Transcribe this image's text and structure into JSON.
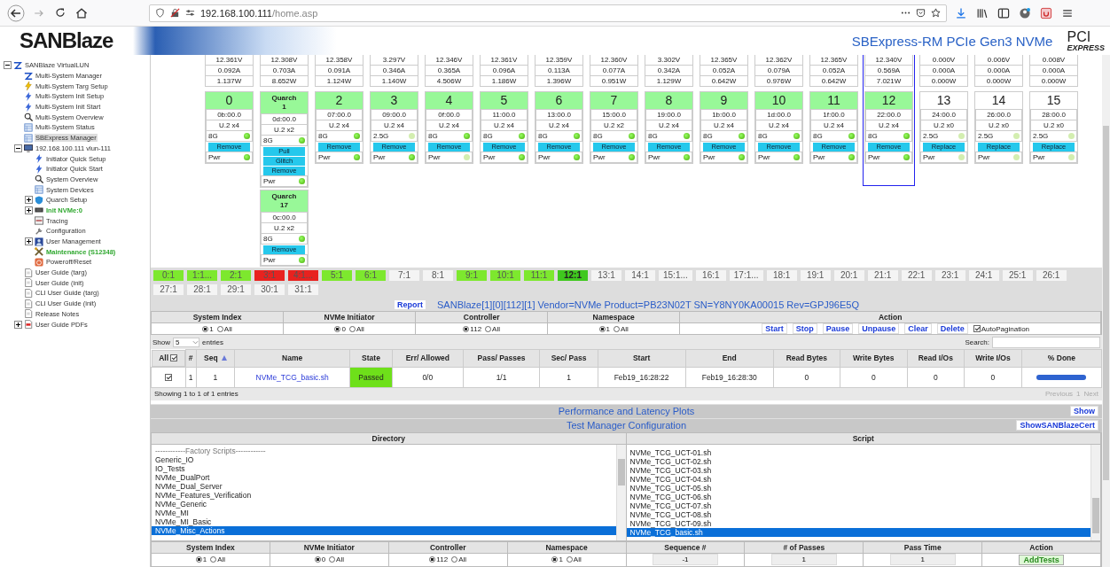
{
  "browser": {
    "url_host": "192.168.100.111",
    "url_path": "/home.asp"
  },
  "header": {
    "logo": "SANBlaze",
    "title": "SBExpress-RM PCIe Gen3 NVMe",
    "pci_logo": "PCI",
    "pci_logo_sub": "EXPRESS"
  },
  "sidebar": {
    "items": [
      {
        "label": "SANBlaze VirtualLUN",
        "kind": "z",
        "expanded": true,
        "selected": false,
        "children": [
          {
            "label": "Multi-System Manager",
            "kind": "z",
            "selected": false
          },
          {
            "label": "Multi-System Targ Setup",
            "kind": "target",
            "selected": false
          },
          {
            "label": "Multi-System Init Setup",
            "kind": "initiator",
            "selected": false
          },
          {
            "label": "Multi-System Init Start",
            "kind": "initiator",
            "selected": false
          },
          {
            "label": "Multi-System Overview",
            "kind": "search",
            "selected": false
          },
          {
            "label": "Multi-System Status",
            "kind": "grid",
            "selected": false
          },
          {
            "label": "SBExpress Manager",
            "kind": "grid",
            "selected": true
          },
          {
            "label": "192.168.100.111 vlun-111",
            "kind": "host",
            "expanded": true,
            "selected": false,
            "children": [
              {
                "label": "Initiator Quick Setup",
                "kind": "initiator",
                "selected": false
              },
              {
                "label": "Initiator Quick Start",
                "kind": "initiator",
                "selected": false
              },
              {
                "label": "System Overview",
                "kind": "search",
                "selected": false
              },
              {
                "label": "System Devices",
                "kind": "grid",
                "selected": false
              },
              {
                "label": "Quarch Setup",
                "kind": "quarch",
                "expanded": false,
                "selected": false
              },
              {
                "label": "Init NVMe:0",
                "kind": "chip",
                "expanded": false,
                "selected": false,
                "color": "#2fa82f"
              },
              {
                "label": "Tracing",
                "kind": "trace",
                "selected": false
              },
              {
                "label": "Configuration",
                "kind": "wrench",
                "selected": false
              },
              {
                "label": "User Management",
                "kind": "users",
                "expanded": false,
                "selected": false
              },
              {
                "label": "Maintenance (S12348)",
                "kind": "tools",
                "selected": false,
                "color": "#2fa82f"
              },
              {
                "label": "Poweroff/Reset",
                "kind": "power",
                "selected": false
              }
            ]
          },
          {
            "label": "User Guide (targ)",
            "kind": "doc",
            "selected": false
          },
          {
            "label": "User Guide (init)",
            "kind": "doc",
            "selected": false
          },
          {
            "label": "CLI User Guide (targ)",
            "kind": "doc",
            "selected": false
          },
          {
            "label": "CLI User Guide (init)",
            "kind": "doc",
            "selected": false
          },
          {
            "label": "Release Notes",
            "kind": "doc",
            "selected": false
          },
          {
            "label": "User Guide PDFs",
            "kind": "pdf",
            "expanded": false,
            "selected": false
          }
        ]
      }
    ]
  },
  "slots": [
    {
      "voltage": "12.361V",
      "current": "0.092A",
      "power": "1.137W",
      "selected": false,
      "cards": [
        {
          "kind": "slot",
          "number": "0",
          "addr": "0b:00.0",
          "form": "U.2 x4",
          "link": "8G",
          "link_on": true,
          "buttons": [
            "Remove"
          ],
          "pwr": "Pwr",
          "pwr_on": true,
          "active": true
        }
      ]
    },
    {
      "voltage": "12.308V",
      "current": "0.703A",
      "power": "8.652W",
      "selected": false,
      "cards": [
        {
          "kind": "quarch",
          "label": "Quarch",
          "number": "1",
          "addr": "0d:00.0",
          "form": "U.2 x2",
          "link": "8G",
          "link_on": true,
          "buttons": [
            "Pull",
            "Glitch",
            "Remove"
          ],
          "pwr": "Pwr",
          "pwr_on": true,
          "active": true
        },
        {
          "kind": "quarch",
          "label": "Quarch",
          "number": "17",
          "addr": "0c:00.0",
          "form": "U.2 x2",
          "link": "8G",
          "link_on": true,
          "buttons": [
            "Remove"
          ],
          "pwr": "Pwr",
          "pwr_on": true,
          "active": true
        }
      ]
    },
    {
      "voltage": "12.358V",
      "current": "0.091A",
      "power": "1.124W",
      "selected": false,
      "cards": [
        {
          "kind": "slot",
          "number": "2",
          "addr": "07:00.0",
          "form": "U.2 x4",
          "link": "8G",
          "link_on": true,
          "buttons": [
            "Remove"
          ],
          "pwr": "Pwr",
          "pwr_on": true,
          "active": true
        }
      ]
    },
    {
      "voltage": "3.297V",
      "current": "0.346A",
      "power": "1.140W",
      "selected": false,
      "cards": [
        {
          "kind": "slot",
          "number": "3",
          "addr": "09:00.0",
          "form": "U.2 x4",
          "link": "2.5G",
          "link_on": false,
          "buttons": [
            "Remove"
          ],
          "pwr": "Pwr",
          "pwr_on": true,
          "active": true
        }
      ]
    },
    {
      "voltage": "12.346V",
      "current": "0.365A",
      "power": "4.506W",
      "selected": false,
      "cards": [
        {
          "kind": "slot",
          "number": "4",
          "addr": "0f:00.0",
          "form": "U.2 x4",
          "link": "8G",
          "link_on": true,
          "buttons": [
            "Remove"
          ],
          "pwr": "Pwr",
          "pwr_on": false,
          "active": true
        }
      ]
    },
    {
      "voltage": "12.361V",
      "current": "0.096A",
      "power": "1.186W",
      "selected": false,
      "cards": [
        {
          "kind": "slot",
          "number": "5",
          "addr": "11:00.0",
          "form": "U.2 x4",
          "link": "8G",
          "link_on": true,
          "buttons": [
            "Remove"
          ],
          "pwr": "Pwr",
          "pwr_on": true,
          "active": true
        }
      ]
    },
    {
      "voltage": "12.359V",
      "current": "0.113A",
      "power": "1.396W",
      "selected": false,
      "cards": [
        {
          "kind": "slot",
          "number": "6",
          "addr": "13:00.0",
          "form": "U.2 x4",
          "link": "8G",
          "link_on": true,
          "buttons": [
            "Remove"
          ],
          "pwr": "Pwr",
          "pwr_on": true,
          "active": true
        }
      ]
    },
    {
      "voltage": "12.360V",
      "current": "0.077A",
      "power": "0.951W",
      "selected": false,
      "cards": [
        {
          "kind": "slot",
          "number": "7",
          "addr": "15:00.0",
          "form": "U.2 x2",
          "link": "8G",
          "link_on": true,
          "buttons": [
            "Remove"
          ],
          "pwr": "Pwr",
          "pwr_on": true,
          "active": true
        }
      ]
    },
    {
      "voltage": "3.302V",
      "current": "0.342A",
      "power": "1.129W",
      "selected": false,
      "cards": [
        {
          "kind": "slot",
          "number": "8",
          "addr": "19:00.0",
          "form": "U.2 x4",
          "link": "8G",
          "link_on": true,
          "buttons": [
            "Remove"
          ],
          "pwr": "Pwr",
          "pwr_on": true,
          "active": true
        }
      ]
    },
    {
      "voltage": "12.365V",
      "current": "0.052A",
      "power": "0.642W",
      "selected": false,
      "cards": [
        {
          "kind": "slot",
          "number": "9",
          "addr": "1b:00.0",
          "form": "U.2 x4",
          "link": "8G",
          "link_on": true,
          "buttons": [
            "Remove"
          ],
          "pwr": "Pwr",
          "pwr_on": true,
          "active": true
        }
      ]
    },
    {
      "voltage": "12.362V",
      "current": "0.079A",
      "power": "0.976W",
      "selected": false,
      "cards": [
        {
          "kind": "slot",
          "number": "10",
          "addr": "1d:00.0",
          "form": "U.2 x4",
          "link": "8G",
          "link_on": true,
          "buttons": [
            "Remove"
          ],
          "pwr": "Pwr",
          "pwr_on": true,
          "active": true
        }
      ]
    },
    {
      "voltage": "12.365V",
      "current": "0.052A",
      "power": "0.642W",
      "selected": false,
      "cards": [
        {
          "kind": "slot",
          "number": "11",
          "addr": "1f:00.0",
          "form": "U.2 x4",
          "link": "8G",
          "link_on": true,
          "buttons": [
            "Remove"
          ],
          "pwr": "Pwr",
          "pwr_on": true,
          "active": true
        }
      ]
    },
    {
      "voltage": "12.340V",
      "current": "0.569A",
      "power": "7.021W",
      "selected": true,
      "cards": [
        {
          "kind": "slot",
          "number": "12",
          "addr": "22:00.0",
          "form": "U.2 x4",
          "link": "8G",
          "link_on": true,
          "buttons": [
            "Remove"
          ],
          "pwr": "Pwr",
          "pwr_on": true,
          "active": true
        }
      ]
    },
    {
      "voltage": "0.000V",
      "current": "0.000A",
      "power": "0.000W",
      "selected": false,
      "cards": [
        {
          "kind": "slot",
          "number": "13",
          "addr": "24:00.0",
          "form": "U.2 x0",
          "link": "2.5G",
          "link_on": false,
          "buttons": [
            "Replace"
          ],
          "pwr": "Pwr",
          "pwr_on": false,
          "active": false
        }
      ]
    },
    {
      "voltage": "0.006V",
      "current": "0.000A",
      "power": "0.000W",
      "selected": false,
      "cards": [
        {
          "kind": "slot",
          "number": "14",
          "addr": "26:00.0",
          "form": "U.2 x0",
          "link": "2.5G",
          "link_on": false,
          "buttons": [
            "Replace"
          ],
          "pwr": "Pwr",
          "pwr_on": false,
          "active": false
        }
      ]
    },
    {
      "voltage": "0.008V",
      "current": "0.000A",
      "power": "0.000W",
      "selected": false,
      "cards": [
        {
          "kind": "slot",
          "number": "15",
          "addr": "28:00.0",
          "form": "U.2 x0",
          "link": "2.5G",
          "link_on": false,
          "buttons": [
            "Replace"
          ],
          "pwr": "Pwr",
          "pwr_on": false,
          "active": false
        }
      ]
    }
  ],
  "ports": [
    {
      "label": "0:1",
      "color": "#7de82e",
      "selected": false
    },
    {
      "label": "1:1...",
      "color": "#7de82e",
      "selected": false
    },
    {
      "label": "2:1",
      "color": "#7de82e",
      "selected": false
    },
    {
      "label": "3:1",
      "color": "#e8221f",
      "selected": false
    },
    {
      "label": "4:1...",
      "color": "#e8221f",
      "selected": false
    },
    {
      "label": "5:1",
      "color": "#7de82e",
      "selected": false
    },
    {
      "label": "6:1",
      "color": "#7de82e",
      "selected": false
    },
    {
      "label": "7:1",
      "color": "#f4f4f4",
      "selected": false
    },
    {
      "label": "8:1",
      "color": "#f4f4f4",
      "selected": false
    },
    {
      "label": "9:1",
      "color": "#7de82e",
      "selected": false
    },
    {
      "label": "10:1",
      "color": "#7de82e",
      "selected": false
    },
    {
      "label": "11:1",
      "color": "#7de82e",
      "selected": false
    },
    {
      "label": "12:1",
      "color": "#3fc81e",
      "selected": true
    },
    {
      "label": "13:1",
      "color": "#f4f4f4",
      "selected": false
    },
    {
      "label": "14:1",
      "color": "#f4f4f4",
      "selected": false
    },
    {
      "label": "15:1...",
      "color": "#f4f4f4",
      "selected": false
    },
    {
      "label": "16:1",
      "color": "#f4f4f4",
      "selected": false
    },
    {
      "label": "17:1...",
      "color": "#f4f4f4",
      "selected": false
    },
    {
      "label": "18:1",
      "color": "#f4f4f4",
      "selected": false
    },
    {
      "label": "19:1",
      "color": "#f4f4f4",
      "selected": false
    },
    {
      "label": "20:1",
      "color": "#f4f4f4",
      "selected": false
    },
    {
      "label": "21:1",
      "color": "#f4f4f4",
      "selected": false
    },
    {
      "label": "22:1",
      "color": "#f4f4f4",
      "selected": false
    },
    {
      "label": "23:1",
      "color": "#f4f4f4",
      "selected": false
    },
    {
      "label": "24:1",
      "color": "#f4f4f4",
      "selected": false
    },
    {
      "label": "25:1",
      "color": "#f4f4f4",
      "selected": false
    },
    {
      "label": "26:1",
      "color": "#f4f4f4",
      "selected": false
    },
    {
      "label": "27:1",
      "color": "#f4f4f4",
      "selected": false
    },
    {
      "label": "28:1",
      "color": "#f4f4f4",
      "selected": false
    },
    {
      "label": "29:1",
      "color": "#f4f4f4",
      "selected": false
    },
    {
      "label": "30:1",
      "color": "#f4f4f4",
      "selected": false
    },
    {
      "label": "31:1",
      "color": "#f4f4f4",
      "selected": false
    }
  ],
  "report": {
    "button": "Report",
    "device": "SANBlaze[1][0][112][1] Vendor=NVMe Product=PB23N02T SN=Y8NY0KA00015 Rev=GPJ96E5Q"
  },
  "filters": [
    {
      "label": "System Index",
      "options": [
        {
          "label": "1",
          "selected": true
        },
        {
          "label": "All",
          "selected": false
        }
      ]
    },
    {
      "label": "NVMe Initiator",
      "options": [
        {
          "label": "0",
          "selected": true
        },
        {
          "label": "All",
          "selected": false
        }
      ]
    },
    {
      "label": "Controller",
      "options": [
        {
          "label": "112",
          "selected": true
        },
        {
          "label": "All",
          "selected": false
        }
      ]
    },
    {
      "label": "Namespace",
      "options": [
        {
          "label": "1",
          "selected": true
        },
        {
          "label": "All",
          "selected": false
        }
      ]
    }
  ],
  "actions": {
    "label": "Action",
    "buttons": [
      "Start",
      "Stop",
      "Pause",
      "Unpause",
      "Clear",
      "Delete"
    ],
    "auto_pagination": {
      "label": "AutoPagination",
      "checked": true
    }
  },
  "list_controls": {
    "show": "Show",
    "page_size": "5",
    "entries": "entries",
    "search": "Search:"
  },
  "table": {
    "all_label": "All",
    "all_checked": true,
    "columns": [
      "#",
      "Seq",
      "Name",
      "State",
      "Err/ Allowed",
      "Pass/ Passes",
      "Sec/ Pass",
      "Start",
      "End",
      "Read Bytes",
      "Write Bytes",
      "Read I/Os",
      "Write I/Os",
      "% Done"
    ],
    "rows": [
      {
        "checked": true,
        "index": "1",
        "seq": "1",
        "name": "NVMe_TCG_basic.sh",
        "state": "Passed",
        "err": "0/0",
        "passes": "1/1",
        "sec": "1",
        "start": "Feb19_16:28:22",
        "end": "Feb19_16:28:30",
        "read_bytes": "0",
        "write_bytes": "0",
        "read_ios": "0",
        "write_ios": "0",
        "level": 1
      }
    ]
  },
  "table_info": "Showing 1 to 1 of 1 entries",
  "pagination": {
    "previous": "Previous",
    "page": "1",
    "next": "Next",
    "disabled": true
  },
  "plots_bar": {
    "title": "Performance and Latency Plots",
    "button": "Show"
  },
  "config_bar": {
    "title": "Test Manager Configuration",
    "button": "ShowSANBlazeCert"
  },
  "directory": {
    "title": "Directory",
    "items": [
      {
        "label": "------------Factory Scripts------------",
        "kind": "heading",
        "selected": false
      },
      {
        "label": "Generic_IO",
        "kind": "item",
        "selected": false
      },
      {
        "label": "IO_Tests",
        "kind": "item",
        "selected": false
      },
      {
        "label": "NVMe_DualPort",
        "kind": "item",
        "selected": false
      },
      {
        "label": "NVMe_Dual_Server",
        "kind": "item",
        "selected": false
      },
      {
        "label": "NVMe_Features_Verification",
        "kind": "item",
        "selected": false
      },
      {
        "label": "NVMe_Generic",
        "kind": "item",
        "selected": false
      },
      {
        "label": "NVMe_MI",
        "kind": "item",
        "selected": false
      },
      {
        "label": "NVMe_MI_Basic",
        "kind": "item",
        "selected": false
      },
      {
        "label": "NVMe_Misc_Actions",
        "kind": "item",
        "selected": true
      }
    ]
  },
  "script": {
    "title": "Script",
    "items": [
      {
        "label": "NVMe_TCG_UCT-01.sh",
        "selected": false
      },
      {
        "label": "NVMe_TCG_UCT-02.sh",
        "selected": false
      },
      {
        "label": "NVMe_TCG_UCT-03.sh",
        "selected": false
      },
      {
        "label": "NVMe_TCG_UCT-04.sh",
        "selected": false
      },
      {
        "label": "NVMe_TCG_UCT-05.sh",
        "selected": false
      },
      {
        "label": "NVMe_TCG_UCT-06.sh",
        "selected": false
      },
      {
        "label": "NVMe_TCG_UCT-07.sh",
        "selected": false
      },
      {
        "label": "NVMe_TCG_UCT-08.sh",
        "selected": false
      },
      {
        "label": "NVMe_TCG_UCT-09.sh",
        "selected": false
      },
      {
        "label": "NVMe_TCG_basic.sh",
        "selected": true
      }
    ]
  },
  "add_form": {
    "filters": [
      {
        "label": "System Index",
        "options": [
          {
            "label": "1",
            "selected": true
          },
          {
            "label": "All",
            "selected": false
          }
        ]
      },
      {
        "label": "NVMe Initiator",
        "options": [
          {
            "label": "0",
            "selected": true
          },
          {
            "label": "All",
            "selected": false
          }
        ]
      },
      {
        "label": "Controller",
        "options": [
          {
            "label": "112",
            "selected": true
          },
          {
            "label": "All",
            "selected": false
          }
        ]
      },
      {
        "label": "Namespace",
        "options": [
          {
            "label": "1",
            "selected": true
          },
          {
            "label": "All",
            "selected": false
          }
        ]
      }
    ],
    "fields": [
      {
        "label": "Sequence #",
        "value": "-1"
      },
      {
        "label": "# of Passes",
        "value": "1"
      },
      {
        "label": "Pass Time",
        "value": "1"
      }
    ],
    "action_label": "Action",
    "button": "AddTests"
  }
}
